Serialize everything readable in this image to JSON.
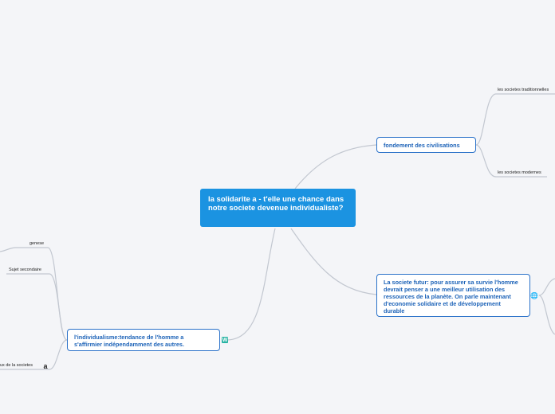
{
  "central": {
    "title": "la solidarite a - t'elle une chance dans notre societe devenue individualiste?"
  },
  "topics": {
    "fondement": {
      "label": "fondement des civilisations",
      "children": [
        "les societes traditionnelles",
        "les societes modernes"
      ]
    },
    "futur": {
      "label": "La societe futur: pour assurer sa survie l'homme devrait penser a une meilleur utilisation des ressources de la planète. On parle maintenant d'economie solidaire et de développement durable"
    },
    "individualisme": {
      "label": "l'individualisme:tendance de l'homme a s'affirmier indépendamment des autres.",
      "children": [
        "genese",
        "Sujet secondaire",
        "ux de la societes"
      ]
    }
  },
  "icons": {
    "individualisme": "wikipedia-icon",
    "futur": "globe-icon",
    "societes": "a-letter-icon"
  },
  "colors": {
    "background": "#f4f5f8",
    "central_fill": "#1b93e1",
    "topic_border": "#2b72c9",
    "topic_text": "#1d63b8",
    "connector": "#c2c7d0"
  }
}
